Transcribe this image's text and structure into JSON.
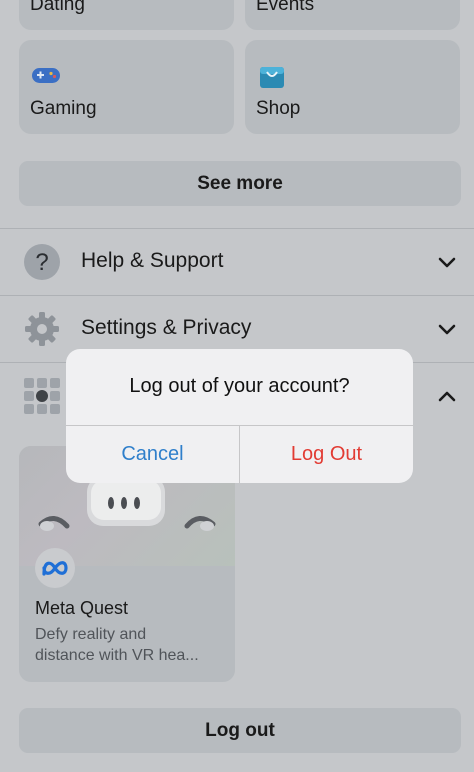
{
  "shortcuts": {
    "dating_label": "Dating",
    "events_label": "Events",
    "gaming_label": "Gaming",
    "shop_label": "Shop"
  },
  "see_more_label": "See more",
  "menu": {
    "help_label": "Help & Support",
    "settings_label": "Settings & Privacy"
  },
  "quest_card": {
    "title": "Meta Quest",
    "desc_line1": "Defy reality and",
    "desc_line2": "distance with VR hea..."
  },
  "logout_label": "Log out",
  "dialog": {
    "title": "Log out of your account?",
    "cancel_label": "Cancel",
    "confirm_label": "Log Out"
  },
  "colors": {
    "cancel": "#2f7fcb",
    "destructive": "#e23b33",
    "dim_background": "#c5c7ca"
  },
  "icons": {
    "gaming": "gamepad-icon",
    "shop": "shopping-bag-icon",
    "help": "question-mark-icon",
    "settings": "gear-icon",
    "more": "grid-icon",
    "meta": "meta-logo-icon"
  }
}
